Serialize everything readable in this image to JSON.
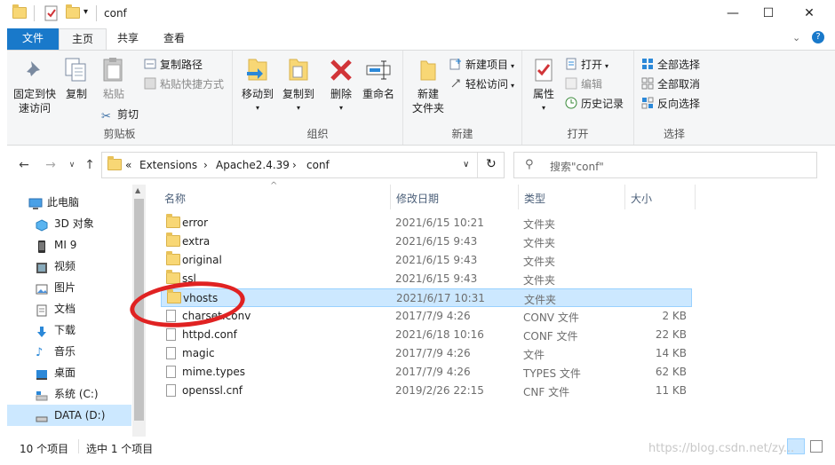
{
  "window": {
    "title": "conf",
    "minimize": "—",
    "maximize": "☐",
    "close": "✕"
  },
  "ribbon_tabs": [
    "文件",
    "主页",
    "共享",
    "查看"
  ],
  "ribbon": {
    "clipboard": {
      "label": "剪贴板",
      "pin": "固定到快\n速访问",
      "copy": "复制",
      "paste": "粘贴",
      "copy_path": "复制路径",
      "paste_shortcut": "粘贴快捷方式",
      "cut": "剪切"
    },
    "organize": {
      "label": "组织",
      "move_to": "移动到",
      "copy_to": "复制到",
      "delete": "删除",
      "rename": "重命名"
    },
    "new": {
      "label": "新建",
      "new_folder": "新建\n文件夹",
      "new_item": "新建项目",
      "easy_access": "轻松访问"
    },
    "open": {
      "label": "打开",
      "properties": "属性",
      "open": "打开",
      "edit": "编辑",
      "history": "历史记录"
    },
    "select": {
      "label": "选择",
      "select_all": "全部选择",
      "select_none": "全部取消",
      "invert": "反向选择"
    }
  },
  "address": {
    "crumbs": [
      "Extensions",
      "Apache2.4.39",
      "conf"
    ],
    "search_placeholder": "搜索\"conf\""
  },
  "nav": [
    {
      "label": "此电脑",
      "icon": "computer-icon"
    },
    {
      "label": "3D 对象",
      "icon": "cube-icon"
    },
    {
      "label": "MI 9",
      "icon": "phone-icon"
    },
    {
      "label": "视频",
      "icon": "video-icon"
    },
    {
      "label": "图片",
      "icon": "picture-icon"
    },
    {
      "label": "文档",
      "icon": "document-icon"
    },
    {
      "label": "下载",
      "icon": "download-icon"
    },
    {
      "label": "音乐",
      "icon": "music-icon"
    },
    {
      "label": "桌面",
      "icon": "desktop-icon"
    },
    {
      "label": "系统 (C:)",
      "icon": "drive-icon"
    },
    {
      "label": "DATA (D:)",
      "icon": "drive-icon"
    }
  ],
  "columns": {
    "name": "名称",
    "modified": "修改日期",
    "type": "类型",
    "size": "大小"
  },
  "files": [
    {
      "name": "error",
      "modified": "2021/6/15 10:21",
      "type": "文件夹",
      "size": "",
      "folder": true
    },
    {
      "name": "extra",
      "modified": "2021/6/15 9:43",
      "type": "文件夹",
      "size": "",
      "folder": true
    },
    {
      "name": "original",
      "modified": "2021/6/15 9:43",
      "type": "文件夹",
      "size": "",
      "folder": true
    },
    {
      "name": "ssl",
      "modified": "2021/6/15 9:43",
      "type": "文件夹",
      "size": "",
      "folder": true
    },
    {
      "name": "vhosts",
      "modified": "2021/6/17 10:31",
      "type": "文件夹",
      "size": "",
      "folder": true,
      "selected": true
    },
    {
      "name": "charset.conv",
      "modified": "2017/7/9 4:26",
      "type": "CONV 文件",
      "size": "2 KB",
      "folder": false
    },
    {
      "name": "httpd.conf",
      "modified": "2021/6/18 10:16",
      "type": "CONF 文件",
      "size": "22 KB",
      "folder": false
    },
    {
      "name": "magic",
      "modified": "2017/7/9 4:26",
      "type": "文件",
      "size": "14 KB",
      "folder": false
    },
    {
      "name": "mime.types",
      "modified": "2017/7/9 4:26",
      "type": "TYPES 文件",
      "size": "62 KB",
      "folder": false
    },
    {
      "name": "openssl.cnf",
      "modified": "2019/2/26 22:15",
      "type": "CNF 文件",
      "size": "11 KB",
      "folder": false
    }
  ],
  "status": {
    "count": "10 个项目",
    "selected": "选中 1 个项目"
  },
  "watermark": "https://blog.csdn.net/zy..."
}
